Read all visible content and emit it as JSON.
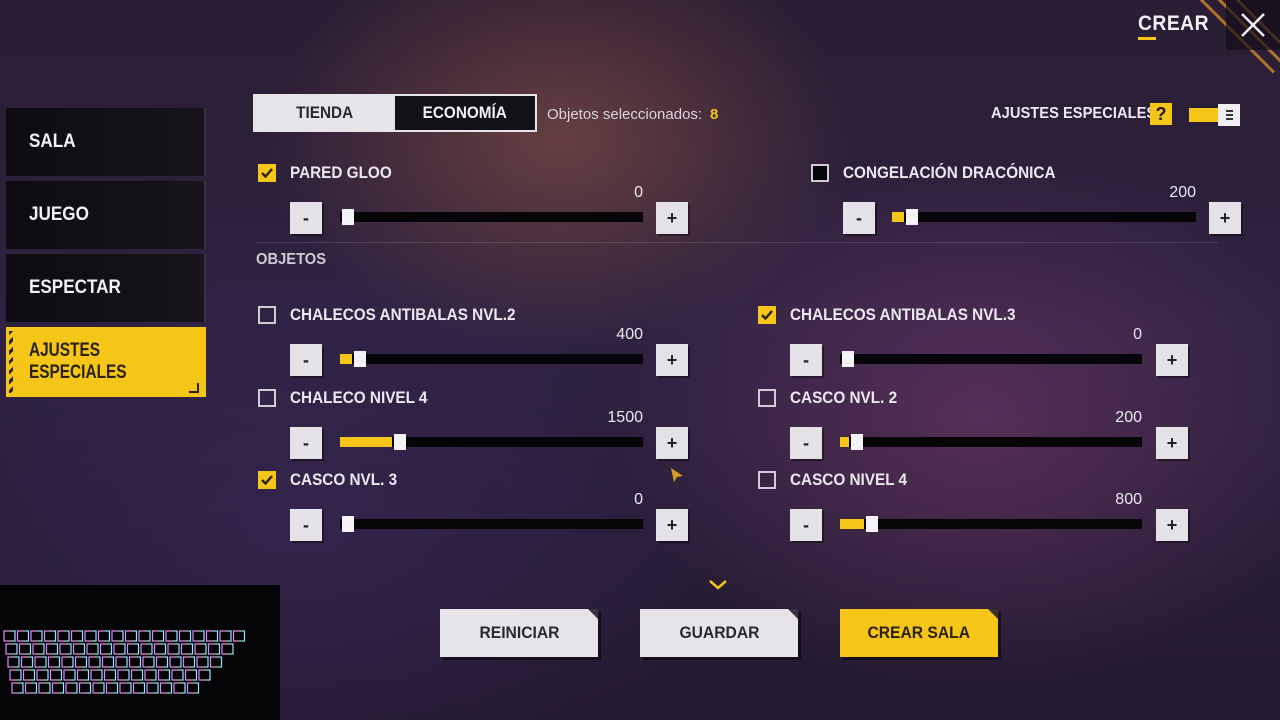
{
  "header": {
    "title": "CREAR"
  },
  "sidebar": {
    "items": [
      {
        "label": "SALA"
      },
      {
        "label": "JUEGO"
      },
      {
        "label": "ESPECTAR"
      },
      {
        "label": "AJUSTES ESPECIALES",
        "line1": "AJUSTES",
        "line2": "ESPECIALES",
        "active": true
      }
    ]
  },
  "tabs": [
    {
      "label": "TIENDA",
      "selected": false
    },
    {
      "label": "ECONOMÍA",
      "selected": true
    }
  ],
  "selection": {
    "label": "Objetos seleccionados:",
    "count": "8"
  },
  "special_settings": {
    "label": "AJUSTES ESPECIALES",
    "help": "?",
    "toggle_on": true
  },
  "section_objetos": "OBJETOS",
  "items": [
    {
      "label": "PARED GLOO",
      "checked": true,
      "value": "0",
      "fill": 0.0
    },
    {
      "label": "CONGELACIÓN DRACÓNICA",
      "checked": false,
      "value": "200",
      "fill": 0.04
    },
    {
      "label": "CHALECOS ANTIBALAS NVL.2",
      "checked": false,
      "value": "400",
      "fill": 0.04
    },
    {
      "label": "CHALECOS ANTIBALAS NVL.3",
      "checked": true,
      "value": "0",
      "fill": 0.0
    },
    {
      "label": "CHALECO NIVEL 4",
      "checked": false,
      "value": "1500",
      "fill": 0.17
    },
    {
      "label": "CASCO NVL. 2",
      "checked": false,
      "value": "200",
      "fill": 0.03
    },
    {
      "label": "CASCO NVL. 3",
      "checked": true,
      "value": "0",
      "fill": 0.0
    },
    {
      "label": "CASCO NIVEL 4",
      "checked": false,
      "value": "800",
      "fill": 0.08
    }
  ],
  "stepper": {
    "minus": "-",
    "plus": "+"
  },
  "actions": {
    "reset": "REINICIAR",
    "save": "GUARDAR",
    "create": "CREAR SALA"
  },
  "colors": {
    "accent": "#f5c518",
    "panel_dark": "#141018",
    "light": "#e6e4e8"
  }
}
